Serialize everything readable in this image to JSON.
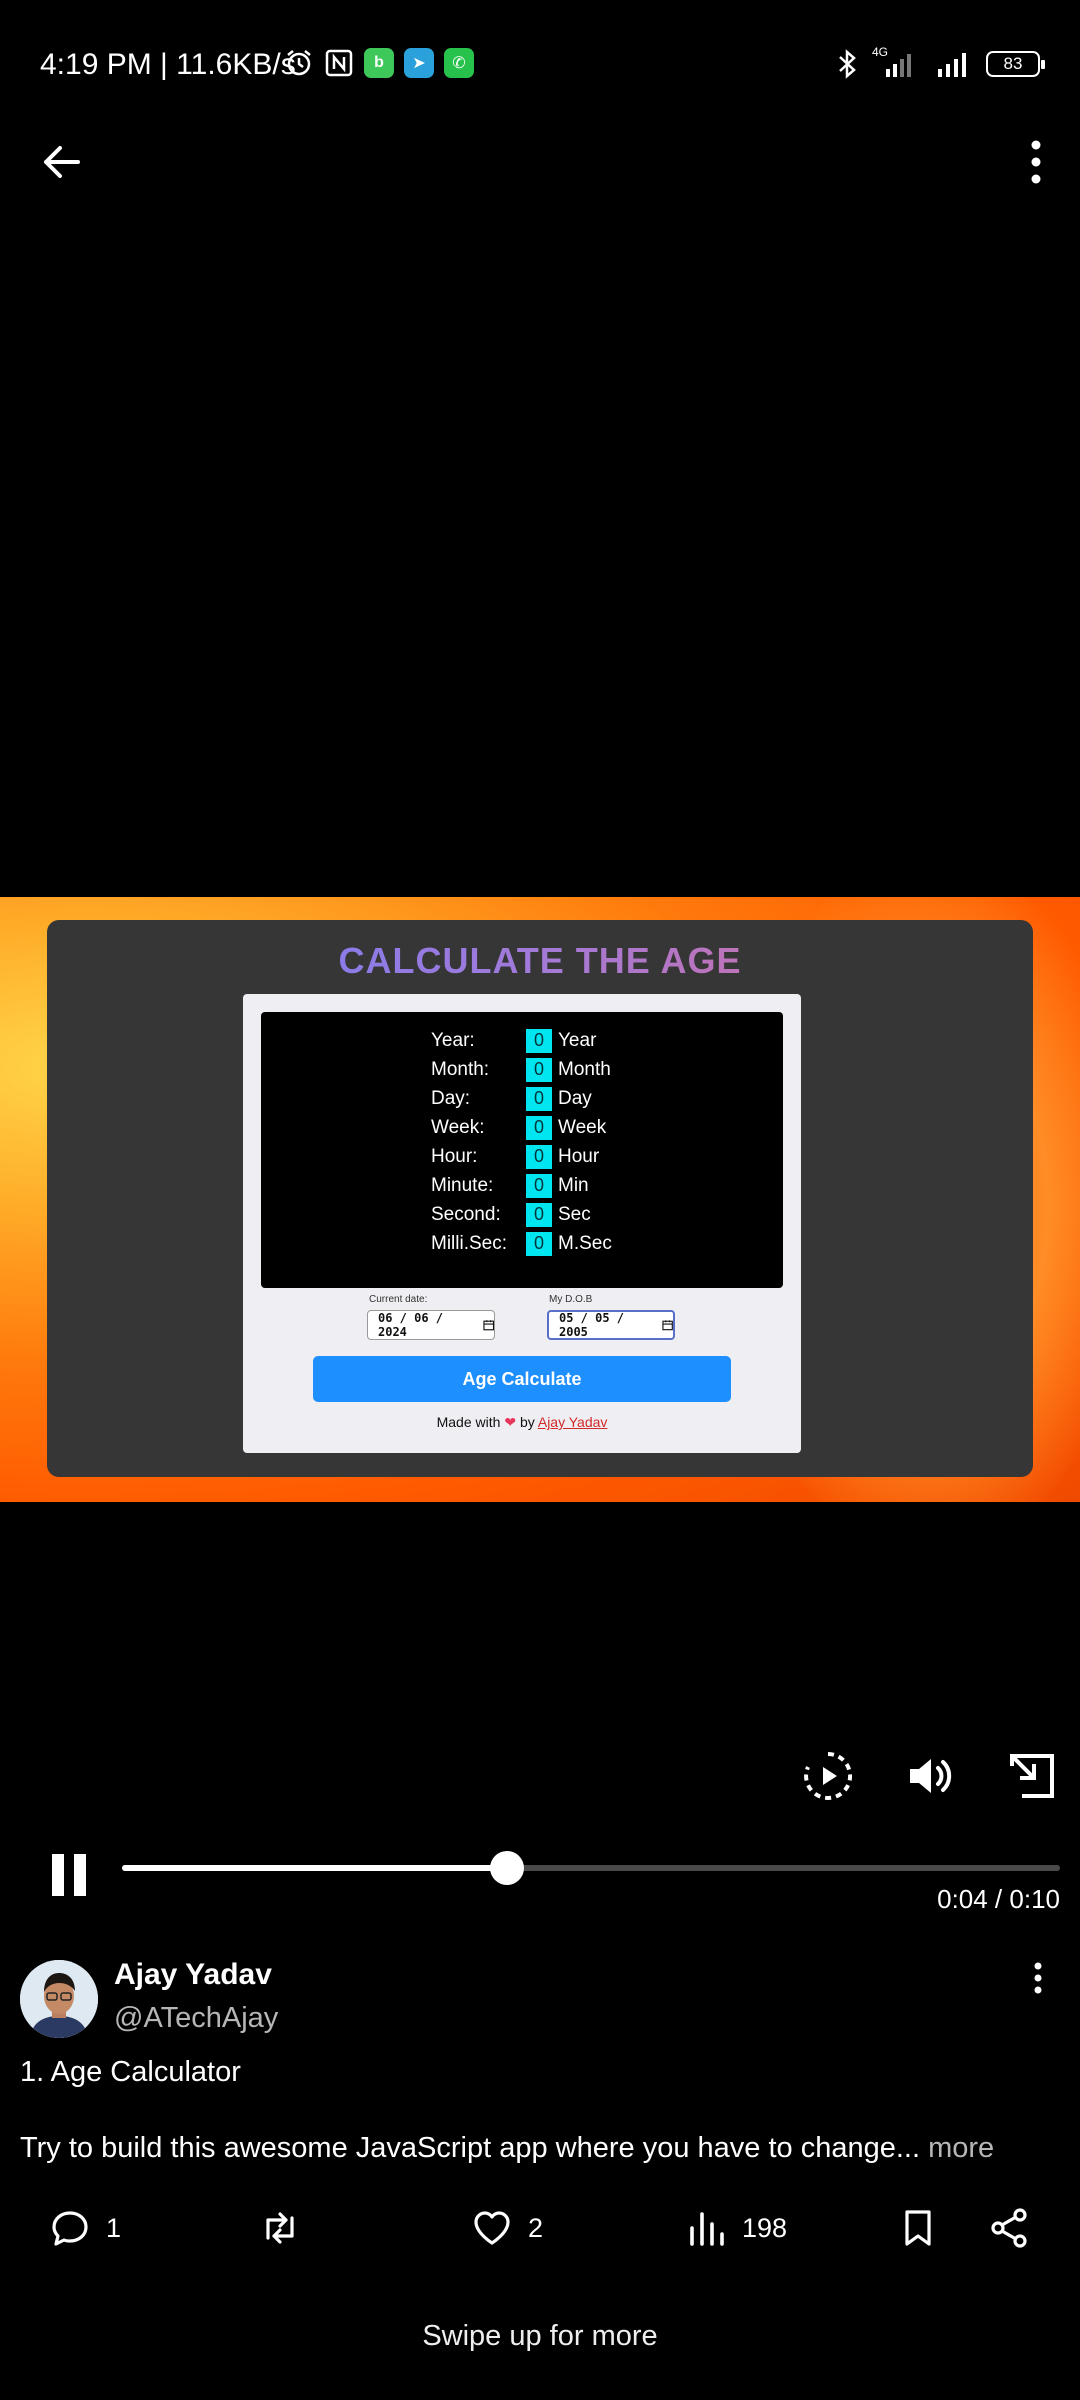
{
  "status_bar": {
    "time": "4:19 PM | 11.6KB/s",
    "network": "4G",
    "battery": "83"
  },
  "video": {
    "calculator": {
      "title": "CALCULATE THE AGE",
      "rows": [
        {
          "label": "Year:",
          "value": "0",
          "unit": "Year"
        },
        {
          "label": "Month:",
          "value": "0",
          "unit": "Month"
        },
        {
          "label": "Day:",
          "value": "0",
          "unit": "Day"
        },
        {
          "label": "Week:",
          "value": "0",
          "unit": "Week"
        },
        {
          "label": "Hour:",
          "value": "0",
          "unit": "Hour"
        },
        {
          "label": "Minute:",
          "value": "0",
          "unit": "Min"
        },
        {
          "label": "Second:",
          "value": "0",
          "unit": "Sec"
        },
        {
          "label": "Milli.Sec:",
          "value": "0",
          "unit": "M.Sec"
        }
      ],
      "current_date_label": "Current date:",
      "current_date_value": "06 / 06 / 2024",
      "dob_label": "My D.O.B",
      "dob_value": "05 / 05 / 2005",
      "button_label": "Age Calculate",
      "footer_prefix": "Made with",
      "footer_by": "by",
      "footer_author": "Ajay Yadav"
    },
    "progress": 0.41,
    "time_display": "0:04 / 0:10"
  },
  "tweet": {
    "name": "Ajay Yadav",
    "handle": "@ATechAjay",
    "line1": "1. Age Calculator",
    "line2": "Try to build this awesome JavaScript app where you have to change...",
    "more": "more"
  },
  "actions": {
    "replies": "1",
    "likes": "2",
    "views": "198"
  },
  "footer": {
    "swipe_text": "Swipe up for more"
  }
}
